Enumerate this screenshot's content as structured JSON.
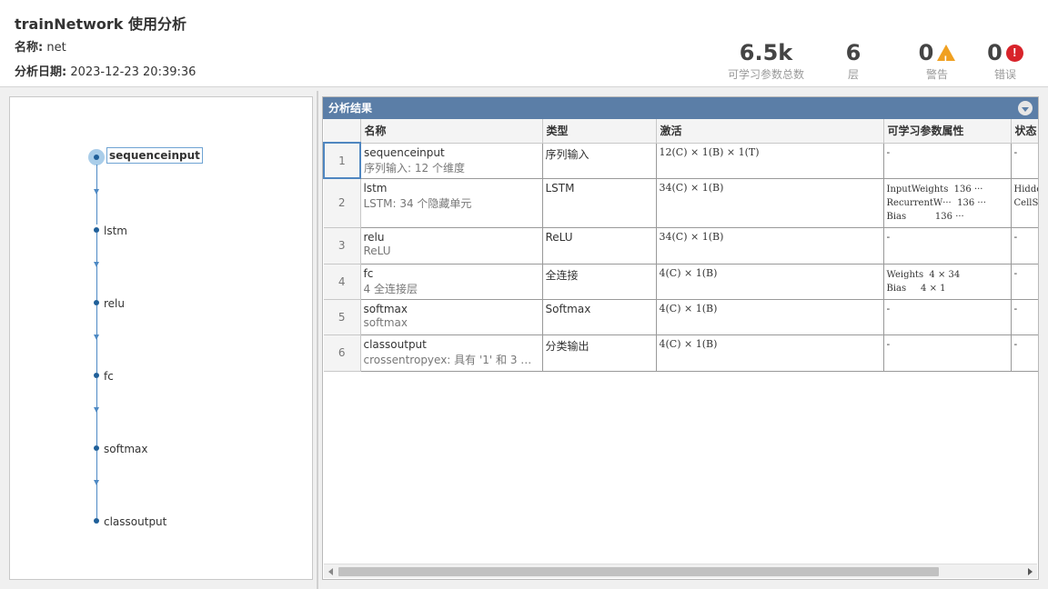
{
  "header": {
    "title": "trainNetwork 使用分析",
    "name_label": "名称:",
    "name_value": "net",
    "date_label": "分析日期:",
    "date_value": "2023-12-23 20:39:36"
  },
  "stats": {
    "params_value": "6.5k",
    "params_label": "可学习参数总数",
    "layers_value": "6",
    "layers_label": "层",
    "warnings_value": "0",
    "warnings_label": "警告",
    "errors_value": "0",
    "errors_label": "错误"
  },
  "graph": {
    "nodes": [
      "sequenceinput",
      "lstm",
      "relu",
      "fc",
      "softmax",
      "classoutput"
    ],
    "selected": "sequenceinput"
  },
  "results": {
    "panel_title": "分析结果",
    "columns": [
      "名称",
      "类型",
      "激活",
      "可学习参数属性",
      "状态"
    ],
    "rows": [
      {
        "idx": "1",
        "name": "sequenceinput",
        "desc": "序列输入: 12 个维度",
        "type": "序列输入",
        "activation": "12(C) × 1(B) × 1(T)",
        "learnables": [
          "-"
        ],
        "state": [
          "-"
        ]
      },
      {
        "idx": "2",
        "name": "lstm",
        "desc": "LSTM: 34 个隐藏单元",
        "type": "LSTM",
        "activation": "34(C) × 1(B)",
        "learnables": [
          "InputWeights  136 ···",
          "RecurrentW···  136 ···",
          "Bias          136 ···"
        ],
        "state": [
          "Hidde",
          "CellS"
        ]
      },
      {
        "idx": "3",
        "name": "relu",
        "desc": "ReLU",
        "type": "ReLU",
        "activation": "34(C) × 1(B)",
        "learnables": [
          "-"
        ],
        "state": [
          "-"
        ]
      },
      {
        "idx": "4",
        "name": "fc",
        "desc": "4 全连接层",
        "type": "全连接",
        "activation": "4(C) × 1(B)",
        "learnables": [
          "Weights  4 × 34",
          "Bias     4 × 1"
        ],
        "state": [
          "-"
        ]
      },
      {
        "idx": "5",
        "name": "softmax",
        "desc": "softmax",
        "type": "Softmax",
        "activation": "4(C) × 1(B)",
        "learnables": [
          "-"
        ],
        "state": [
          "-"
        ]
      },
      {
        "idx": "6",
        "name": "classoutput",
        "desc": "crossentropyex: 具有 '1' 和 3 个其...",
        "type": "分类输出",
        "activation": "4(C) × 1(B)",
        "learnables": [
          "-"
        ],
        "state": [
          "-"
        ]
      }
    ]
  },
  "colors": {
    "panel_header": "#5b7ea7",
    "graph_node": "#1f5f99",
    "warning": "#f0a020",
    "error": "#d8232a"
  }
}
